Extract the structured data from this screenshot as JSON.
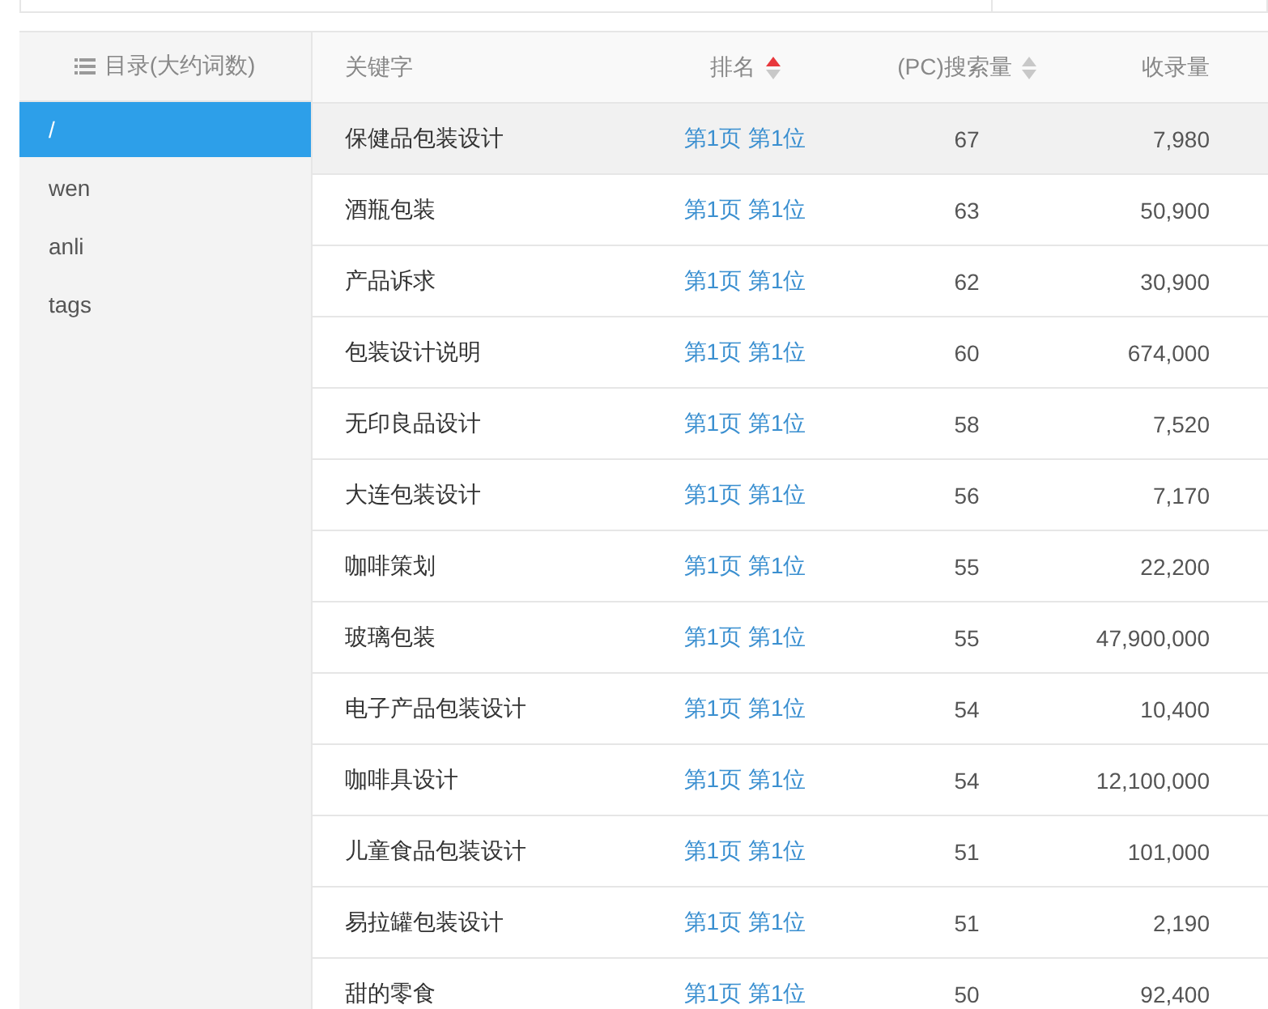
{
  "sidebar": {
    "header": "目录(大约词数)",
    "items": [
      {
        "label": "/",
        "selected": true
      },
      {
        "label": "wen",
        "selected": false
      },
      {
        "label": "anli",
        "selected": false
      },
      {
        "label": "tags",
        "selected": false
      }
    ]
  },
  "table": {
    "columns": [
      {
        "label": "关键字",
        "kind": "plain"
      },
      {
        "label": "排名",
        "kind": "sortable",
        "sorted": true
      },
      {
        "label": "(PC)搜索量",
        "kind": "sortable",
        "sorted": false
      },
      {
        "label": "收录量",
        "kind": "plain"
      }
    ],
    "rows": [
      {
        "keyword": "保健品包装设计",
        "rank": "第1页 第1位",
        "search": "67",
        "indexed": "7,980",
        "highlighted": true
      },
      {
        "keyword": "酒瓶包装",
        "rank": "第1页 第1位",
        "search": "63",
        "indexed": "50,900",
        "highlighted": false
      },
      {
        "keyword": "产品诉求",
        "rank": "第1页 第1位",
        "search": "62",
        "indexed": "30,900",
        "highlighted": false
      },
      {
        "keyword": "包装设计说明",
        "rank": "第1页 第1位",
        "search": "60",
        "indexed": "674,000",
        "highlighted": false
      },
      {
        "keyword": "无印良品设计",
        "rank": "第1页 第1位",
        "search": "58",
        "indexed": "7,520",
        "highlighted": false
      },
      {
        "keyword": "大连包装设计",
        "rank": "第1页 第1位",
        "search": "56",
        "indexed": "7,170",
        "highlighted": false
      },
      {
        "keyword": "咖啡策划",
        "rank": "第1页 第1位",
        "search": "55",
        "indexed": "22,200",
        "highlighted": false
      },
      {
        "keyword": "玻璃包装",
        "rank": "第1页 第1位",
        "search": "55",
        "indexed": "47,900,000",
        "highlighted": false
      },
      {
        "keyword": "电子产品包装设计",
        "rank": "第1页 第1位",
        "search": "54",
        "indexed": "10,400",
        "highlighted": false
      },
      {
        "keyword": "咖啡具设计",
        "rank": "第1页 第1位",
        "search": "54",
        "indexed": "12,100,000",
        "highlighted": false
      },
      {
        "keyword": "儿童食品包装设计",
        "rank": "第1页 第1位",
        "search": "51",
        "indexed": "101,000",
        "highlighted": false
      },
      {
        "keyword": "易拉罐包装设计",
        "rank": "第1页 第1位",
        "search": "51",
        "indexed": "2,190",
        "highlighted": false
      },
      {
        "keyword": "甜的零食",
        "rank": "第1页 第1位",
        "search": "50",
        "indexed": "92,400",
        "highlighted": false
      }
    ]
  }
}
